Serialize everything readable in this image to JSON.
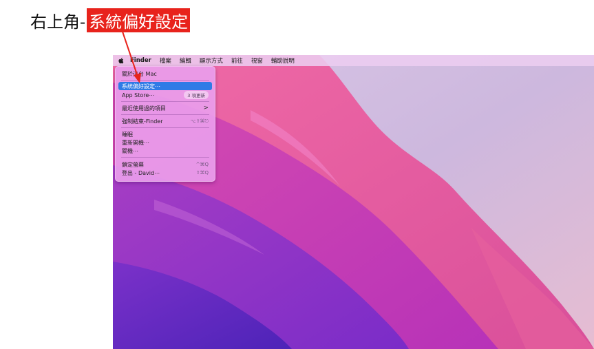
{
  "caption": {
    "prefix": "右上角-",
    "highlight": "系統偏好設定"
  },
  "menubar": {
    "apple_icon": "apple-logo-icon",
    "items": [
      {
        "label": "Finder",
        "bold": true
      },
      {
        "label": "檔案"
      },
      {
        "label": "編輯"
      },
      {
        "label": "顯示方式"
      },
      {
        "label": "前往"
      },
      {
        "label": "視窗"
      },
      {
        "label": "輔助說明"
      }
    ]
  },
  "apple_menu": {
    "about": "關於這台 Mac",
    "system_prefs": "系統偏好設定⋯",
    "app_store": "App Store⋯",
    "app_store_badge": "3 項更新",
    "recent_items": "最近使用過的項目",
    "recent_items_chevron": ">",
    "force_quit": "強制結束-Finder",
    "force_quit_shortcut": "⌥⇧⌘⎋",
    "sleep": "睡眠",
    "restart": "重新開機⋯",
    "shutdown": "關機⋯",
    "lock_screen": "鎖定螢幕",
    "lock_screen_shortcut": "^⌘Q",
    "logout": "登出 - David⋯",
    "logout_shortcut": "⇧⌘Q"
  },
  "colors": {
    "annotation_red": "#e8231c",
    "menu_highlight": "#2f7be6"
  }
}
